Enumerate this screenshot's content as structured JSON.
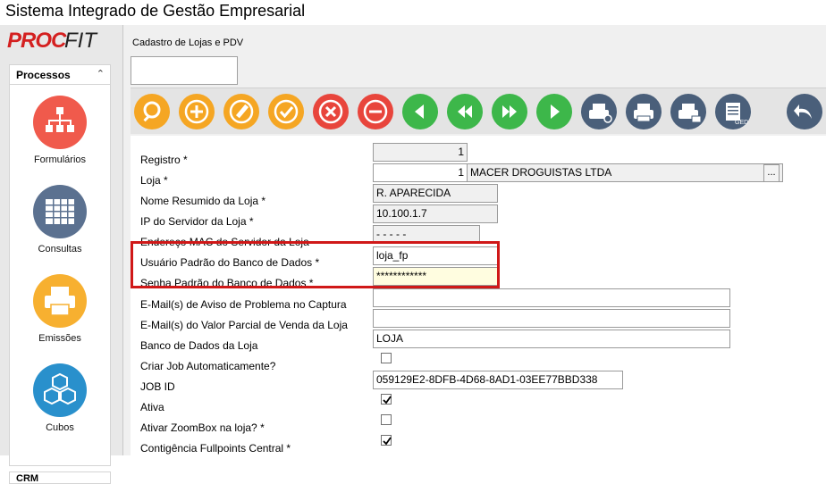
{
  "app": {
    "title": "Sistema Integrado de Gestão Empresarial",
    "logo_proc": "PROC",
    "logo_fit": "FIT"
  },
  "sidebar": {
    "section": "Processos",
    "collapse": "≈",
    "items": [
      {
        "label": "Formulários",
        "color": "#f05a4c"
      },
      {
        "label": "Consultas",
        "color": "#5b7190"
      },
      {
        "label": "Emissões",
        "color": "#f7b030"
      },
      {
        "label": "Cubos",
        "color": "#2990cc"
      }
    ],
    "next_section": "CRM"
  },
  "window": {
    "title": "Cadastro de Lojas e PDV"
  },
  "toolbar": {
    "buttons": [
      {
        "name": "search",
        "color": "#f5a623"
      },
      {
        "name": "add",
        "color": "#f5a623"
      },
      {
        "name": "edit",
        "color": "#f5a623"
      },
      {
        "name": "confirm",
        "color": "#f5a623"
      },
      {
        "name": "cancel",
        "color": "#e8453c"
      },
      {
        "name": "delete",
        "color": "#e8453c"
      },
      {
        "name": "prev",
        "color": "#3db74a"
      },
      {
        "name": "first",
        "color": "#3db74a"
      },
      {
        "name": "last",
        "color": "#3db74a"
      },
      {
        "name": "next",
        "color": "#3db74a"
      },
      {
        "name": "print-preview",
        "color": "#4a5f7a"
      },
      {
        "name": "print",
        "color": "#4a5f7a"
      },
      {
        "name": "print-email",
        "color": "#4a5f7a"
      },
      {
        "name": "ged",
        "color": "#4a5f7a"
      },
      {
        "name": "back",
        "color": "#4a5f7a"
      }
    ],
    "ged_label": "GED"
  },
  "form": {
    "registro": {
      "label": "Registro *",
      "value": "1"
    },
    "loja": {
      "label": "Loja *",
      "code": "1",
      "name": "MACER DROGUISTAS LTDA",
      "lookup": "..."
    },
    "nome_resumido": {
      "label": "Nome Resumido da Loja *",
      "value": "R. APARECIDA"
    },
    "ip_servidor": {
      "label": "IP do Servidor da Loja *",
      "value": "10.100.1.7"
    },
    "mac_servidor": {
      "label": "Endereço MAC do Servidor da Loja",
      "value": " -  -  -  -  - "
    },
    "usuario_bd": {
      "label": "Usuário Padrão do Banco de Dados *",
      "value": "loja_fp"
    },
    "senha_bd": {
      "label": "Senha Padrão do Banco de Dados *",
      "value": "************"
    },
    "email_aviso": {
      "label": "E-Mail(s) de Aviso de Problema no Captura",
      "value": ""
    },
    "email_parcial": {
      "label": "E-Mail(s) do Valor Parcial de Venda da Loja",
      "value": ""
    },
    "banco_dados": {
      "label": "Banco de Dados da Loja",
      "value": "LOJA"
    },
    "criar_job": {
      "label": "Criar Job Automaticamente?",
      "checked": false
    },
    "job_id": {
      "label": "JOB ID",
      "value": "059129E2-8DFB-4D68-8AD1-03EE77BBD338"
    },
    "ativa": {
      "label": "Ativa",
      "checked": true
    },
    "zoombox": {
      "label": "Ativar ZoomBox na loja? *",
      "checked": false
    },
    "contingencia": {
      "label": "Contigência Fullpoints Central *",
      "checked": true
    }
  },
  "highlight_color": "#d01818"
}
